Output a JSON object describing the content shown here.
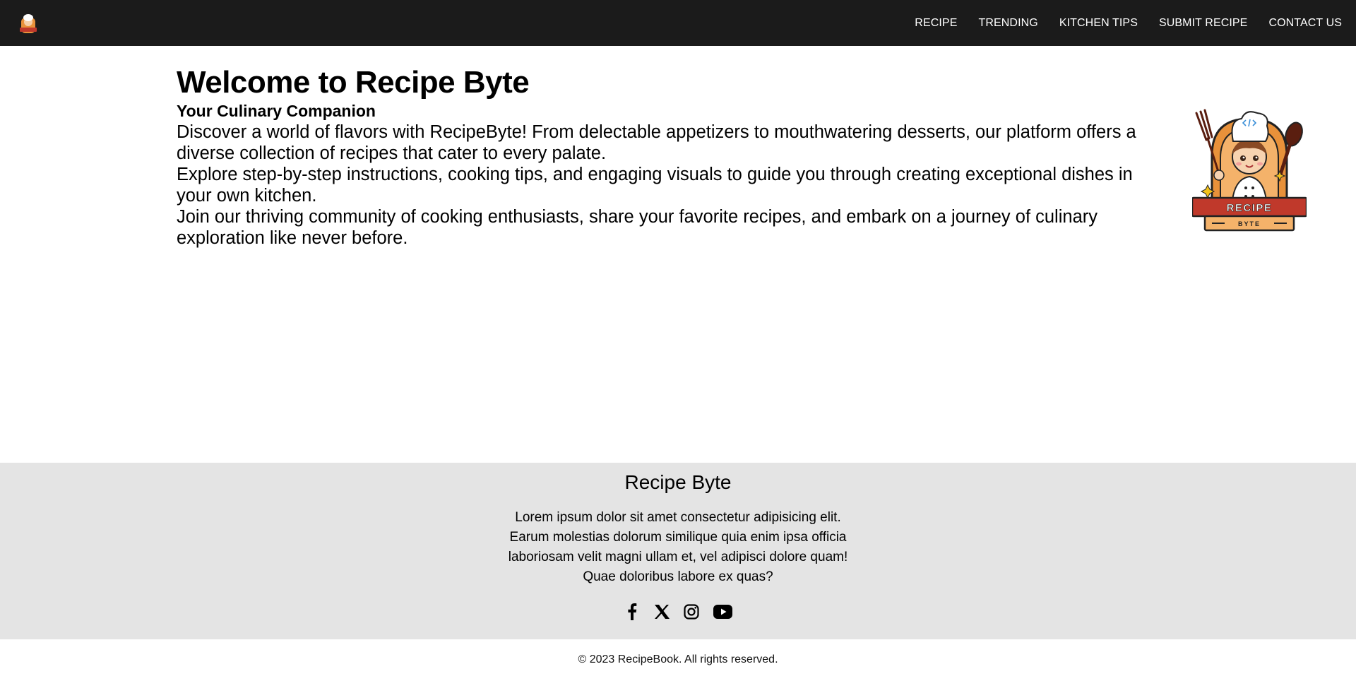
{
  "header": {
    "logo_icon": "chef-logo-icon",
    "nav": [
      {
        "label": "RECIPE"
      },
      {
        "label": "TRENDING"
      },
      {
        "label": "KITCHEN TIPS"
      },
      {
        "label": "SUBMIT RECIPE"
      },
      {
        "label": "CONTACT US"
      }
    ]
  },
  "main": {
    "title": "Welcome to Recipe Byte",
    "subtitle": "Your Culinary Companion",
    "paragraphs": [
      "Discover a world of flavors with RecipeByte! From delectable appetizers to mouthwatering desserts, our platform offers a diverse collection of recipes that cater to every palate.",
      "Explore step-by-step instructions, cooking tips, and engaging visuals to guide you through creating exceptional dishes in your own kitchen.",
      "Join our thriving community of cooking enthusiasts, share your favorite recipes, and embark on a journey of culinary exploration like never before."
    ],
    "mascot": {
      "banner_text": "RECIPE",
      "sub_text": "BYTE"
    }
  },
  "footer": {
    "title": "Recipe Byte",
    "description": "Lorem ipsum dolor sit amet consectetur adipisicing elit. Earum molestias dolorum similique quia enim ipsa officia laboriosam velit magni ullam et, vel adipisci dolore quam! Quae doloribus labore ex quas?",
    "socials": [
      "facebook-icon",
      "x-icon",
      "instagram-icon",
      "youtube-icon"
    ],
    "copyright": "© 2023 RecipeBook. All rights reserved."
  },
  "colors": {
    "navbar_bg": "#1b1b1b",
    "footer_bg": "#e4e4e4",
    "brand_orange": "#e8913a",
    "brand_red": "#c0392b"
  }
}
